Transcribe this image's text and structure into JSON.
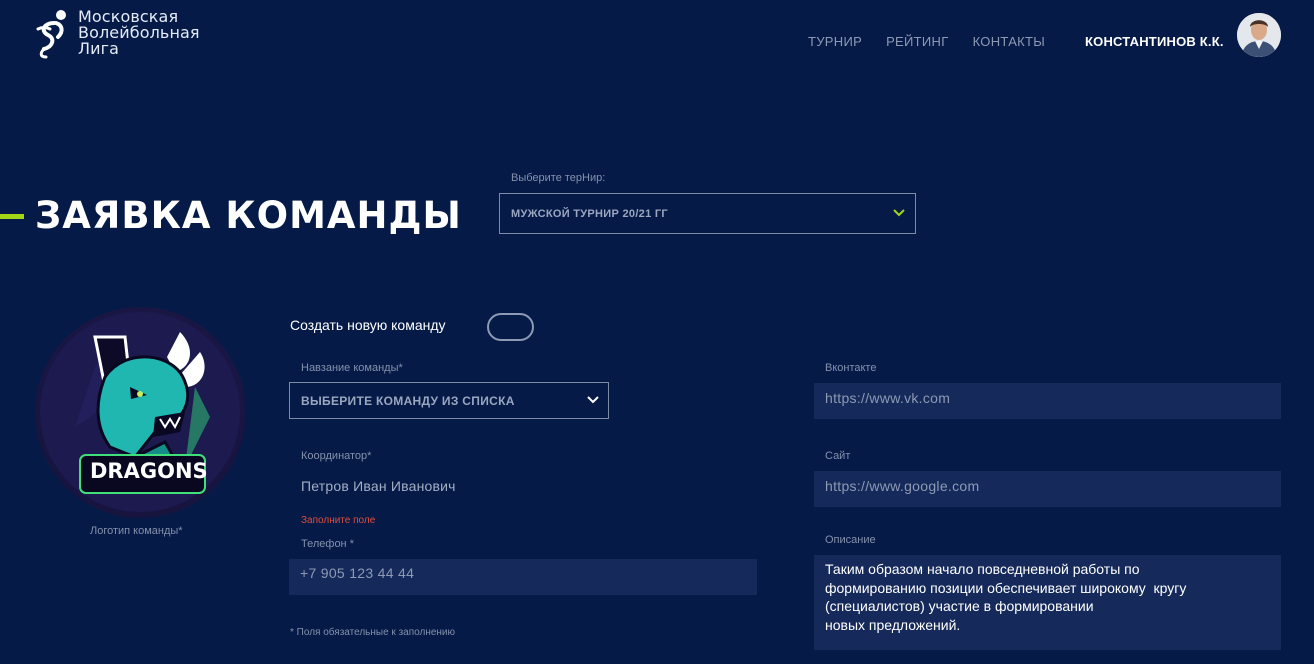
{
  "header": {
    "logo_lines": [
      "Московская",
      "Волейбольная",
      "Лига"
    ],
    "nav": [
      "ТУРНИР",
      "РЕЙТИНГ",
      "КОНТАКТЫ"
    ],
    "user_name": "КОНСТАНТИНОВ К.К."
  },
  "page": {
    "title": "ЗАЯВКА КОМАНДЫ",
    "accent_color": "#a3d518"
  },
  "tournament": {
    "label": "Выберите терНир:",
    "value": "МУЖСКОЙ ТУРНИР 20/21 ГГ"
  },
  "team_logo": {
    "text": "DRAGONS",
    "caption": "Логотип команды*"
  },
  "create_toggle": {
    "label": "Создать новую команду",
    "on": false
  },
  "form": {
    "team_name": {
      "label": "Навзание команды*",
      "value": "ВЫБЕРИТЕ КОМАНДУ ИЗ СПИСКА"
    },
    "coordinator": {
      "label": "Координатор*",
      "value": "Петров Иван Иванович",
      "error": "Заполните поле"
    },
    "phone": {
      "label": "Телефон *",
      "value": "+7 905 123 44 44"
    },
    "vk": {
      "label": "Вконтакте",
      "value": "https://www.vk.com"
    },
    "site": {
      "label": "Сайт",
      "value": "https://www.google.com"
    },
    "description": {
      "label": "Описание",
      "lines": [
        "Таким образом начало повседневной работы по",
        "формированию позиции обеспечивает широкому  кругу",
        "(специалистов) участие в формировании",
        "новых предложений."
      ]
    },
    "footnote": "* Поля обязательные к заполнению"
  }
}
